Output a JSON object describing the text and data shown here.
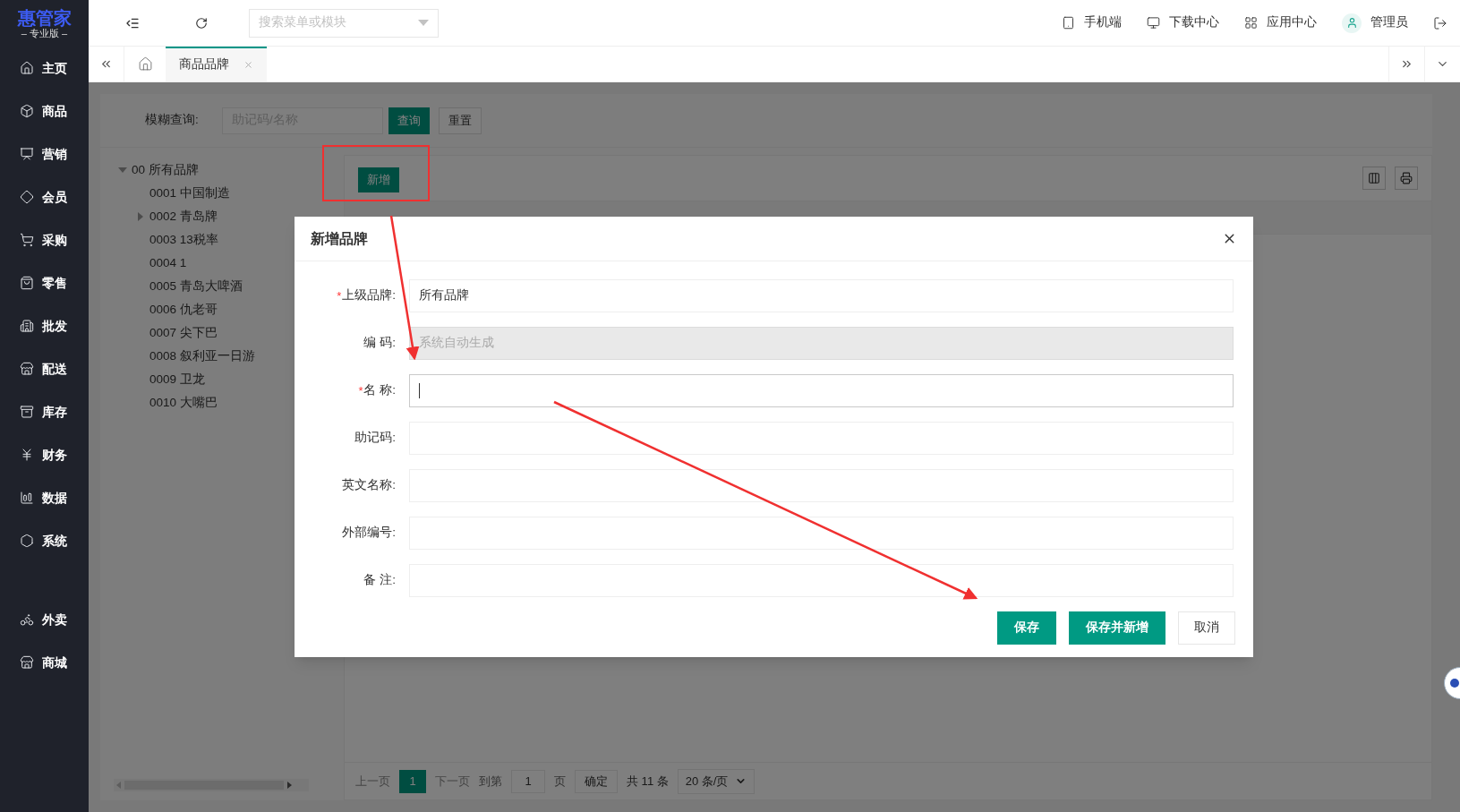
{
  "logo": {
    "name": "惠管家",
    "edition": "– 专业版 –"
  },
  "sidebar": {
    "items": [
      {
        "label": "主页"
      },
      {
        "label": "商品"
      },
      {
        "label": "营销"
      },
      {
        "label": "会员"
      },
      {
        "label": "采购"
      },
      {
        "label": "零售"
      },
      {
        "label": "批发"
      },
      {
        "label": "配送"
      },
      {
        "label": "库存"
      },
      {
        "label": "财务"
      },
      {
        "label": "数据"
      },
      {
        "label": "系统"
      }
    ],
    "extra_items": [
      {
        "label": "外卖"
      },
      {
        "label": "商城"
      }
    ]
  },
  "topbar": {
    "search": {
      "placeholder": "搜索菜单或模块"
    },
    "links": [
      {
        "label": "手机端"
      },
      {
        "label": "下载中心"
      },
      {
        "label": "应用中心"
      },
      {
        "label": "管理员"
      }
    ]
  },
  "tabs": [
    {
      "label": "商品品牌",
      "selected": true
    }
  ],
  "filter": {
    "label": "模糊查询:",
    "placeholder": "助记码/名称",
    "buttons": [
      {
        "label": "查询",
        "kind": "primary"
      },
      {
        "label": "重置",
        "kind": "default"
      }
    ]
  },
  "tree": [
    {
      "label": "00 所有品牌",
      "expanded": true,
      "children": [
        {
          "label": "0001 中国制造"
        },
        {
          "label": "0002 青岛牌",
          "expanded": false
        },
        {
          "label": "0003 13税率"
        },
        {
          "label": "0004 1"
        },
        {
          "label": "0005 青岛大啤酒"
        },
        {
          "label": "0006 仇老哥"
        },
        {
          "label": "0007 尖下巴"
        },
        {
          "label": "0008 叙利亚一日游"
        },
        {
          "label": "0009 卫龙"
        },
        {
          "label": "0010 大嘴巴"
        }
      ]
    }
  ],
  "toolbar": {
    "add_button": "新增"
  },
  "pagination": {
    "prev": "上一页",
    "pages": [
      {
        "label": "1",
        "selected": true
      }
    ],
    "next": "下一页",
    "goto": "到第",
    "page_input": "1",
    "page_unit": "页",
    "confirm": "确定",
    "total": "共 11 条",
    "page_size": "20 条/页"
  },
  "dialog": {
    "title": "新增品牌",
    "required_mark": "*",
    "fields": [
      {
        "label": "上级品牌:",
        "required": true,
        "value": "所有品牌",
        "disabled": false,
        "focused": false
      },
      {
        "label": "编 码:",
        "required": false,
        "placeholder": "系统自动生成",
        "disabled": true,
        "focused": false
      },
      {
        "label": "名 称:",
        "required": true,
        "disabled": false,
        "focused": true
      },
      {
        "label": "助记码:",
        "required": false,
        "disabled": false,
        "focused": false
      },
      {
        "label": "英文名称:",
        "required": false,
        "disabled": false,
        "focused": false
      },
      {
        "label": "外部编号:",
        "required": false,
        "disabled": false,
        "focused": false
      },
      {
        "label": "备 注:",
        "required": false,
        "disabled": false,
        "focused": false
      }
    ],
    "buttons": [
      {
        "label": "保存",
        "kind": "primary"
      },
      {
        "label": "保存并新增",
        "kind": "primary"
      },
      {
        "label": "取消",
        "kind": "default"
      }
    ]
  }
}
